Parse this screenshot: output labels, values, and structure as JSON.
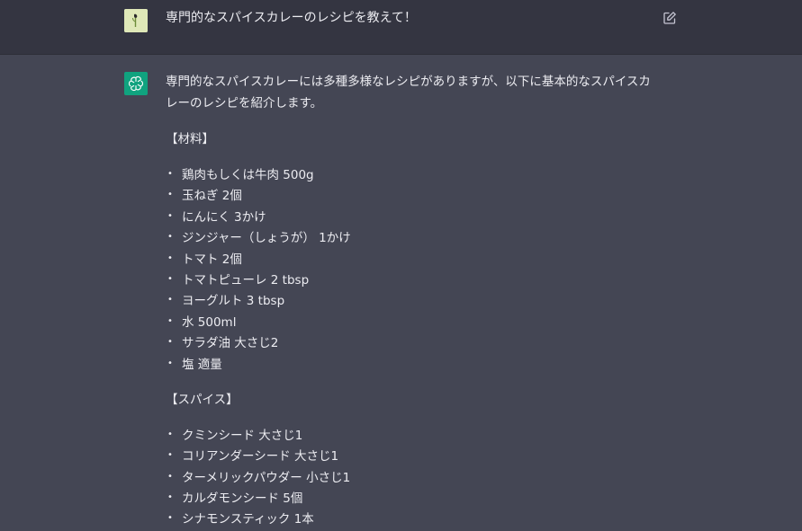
{
  "user_message": {
    "text": "専門的なスパイスカレーのレシピを教えて！"
  },
  "assistant_message": {
    "intro": "専門的なスパイスカレーには多種多様なレシピがありますが、以下に基本的なスパイスカレーのレシピを紹介します。",
    "sections": [
      {
        "heading": "【材料】",
        "items": [
          "鶏肉もしくは牛肉 500g",
          "玉ねぎ 2個",
          "にんにく 3かけ",
          "ジンジャー（しょうが） 1かけ",
          "トマト 2個",
          "トマトピューレ 2 tbsp",
          "ヨーグルト 3 tbsp",
          "水 500ml",
          "サラダ油 大さじ2",
          "塩 適量"
        ]
      },
      {
        "heading": "【スパイス】",
        "items": [
          "クミンシード 大さじ1",
          "コリアンダーシード 大さじ1",
          "ターメリックパウダー 小さじ1",
          "カルダモンシード 5個",
          "シナモンスティック 1本"
        ]
      }
    ]
  },
  "icons": {
    "edit": "edit-icon",
    "bot": "openai-logo-icon",
    "user": "user-avatar"
  },
  "colors": {
    "user_bg": "#343541",
    "assistant_bg": "#444654",
    "bot_avatar": "#10a37f",
    "text": "#ececf1"
  }
}
